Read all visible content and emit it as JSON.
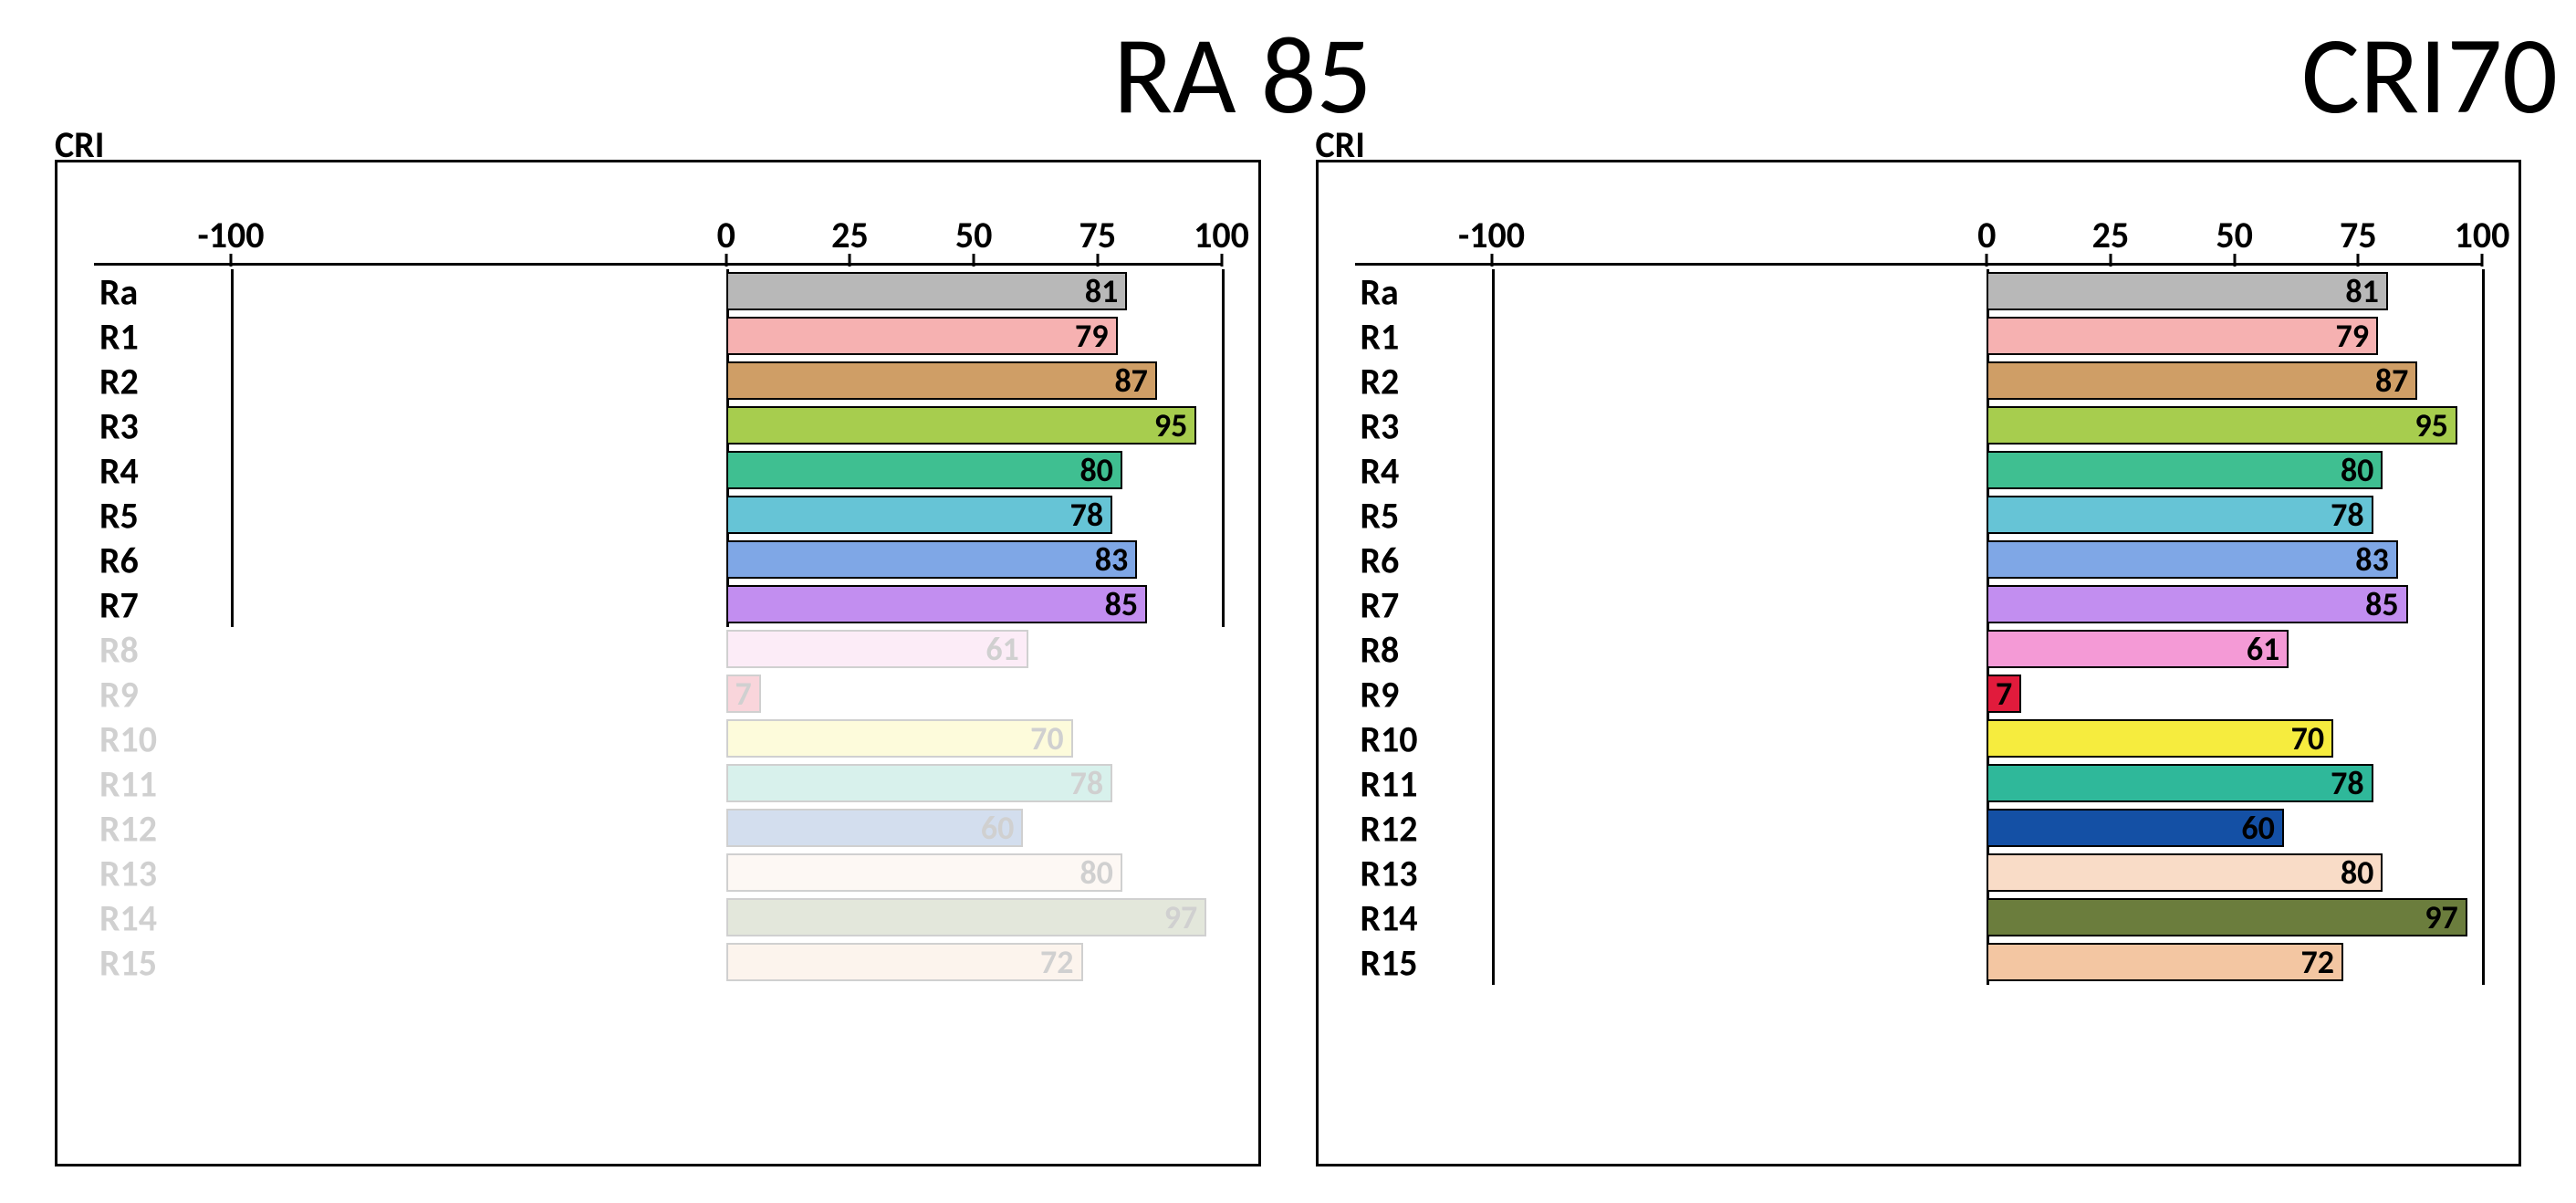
{
  "titles": {
    "left": "RA 85",
    "right": "CRI70"
  },
  "chart_label": "CRI",
  "axis": {
    "ticks": [
      -100,
      0,
      25,
      50,
      75,
      100
    ],
    "min": -100,
    "max": 100
  },
  "chart_data": [
    {
      "type": "bar",
      "title": "CRI (RA 85)",
      "xlabel": "",
      "ylabel": "",
      "xlim": [
        -100,
        100
      ],
      "categories": [
        "Ra",
        "R1",
        "R2",
        "R3",
        "R4",
        "R5",
        "R6",
        "R7",
        "R8",
        "R9",
        "R10",
        "R11",
        "R12",
        "R13",
        "R14",
        "R15"
      ],
      "values": [
        81,
        79,
        87,
        95,
        80,
        78,
        83,
        85,
        61,
        7,
        70,
        78,
        60,
        80,
        97,
        72
      ],
      "colors": [
        "#b8b8b8",
        "#f6b1b1",
        "#cf9e66",
        "#a7cd4e",
        "#3fbf91",
        "#66c4d6",
        "#7fa7e6",
        "#c28ef0",
        "#f49ad6",
        "#e11b3c",
        "#f6ec3e",
        "#2fb89a",
        "#1450a5",
        "#f9dcc7",
        "#6b7d3d",
        "#f3c6a2"
      ],
      "active_count": 8
    },
    {
      "type": "bar",
      "title": "CRI (CRI70)",
      "xlabel": "",
      "ylabel": "",
      "xlim": [
        -100,
        100
      ],
      "categories": [
        "Ra",
        "R1",
        "R2",
        "R3",
        "R4",
        "R5",
        "R6",
        "R7",
        "R8",
        "R9",
        "R10",
        "R11",
        "R12",
        "R13",
        "R14",
        "R15"
      ],
      "values": [
        81,
        79,
        87,
        95,
        80,
        78,
        83,
        85,
        61,
        7,
        70,
        78,
        60,
        80,
        97,
        72
      ],
      "colors": [
        "#b8b8b8",
        "#f6b1b1",
        "#cf9e66",
        "#a7cd4e",
        "#3fbf91",
        "#66c4d6",
        "#7fa7e6",
        "#c28ef0",
        "#f49ad6",
        "#e11b3c",
        "#f6ec3e",
        "#2fb89a",
        "#1450a5",
        "#f9dcc7",
        "#6b7d3d",
        "#f3c6a2"
      ],
      "active_count": 16
    }
  ]
}
